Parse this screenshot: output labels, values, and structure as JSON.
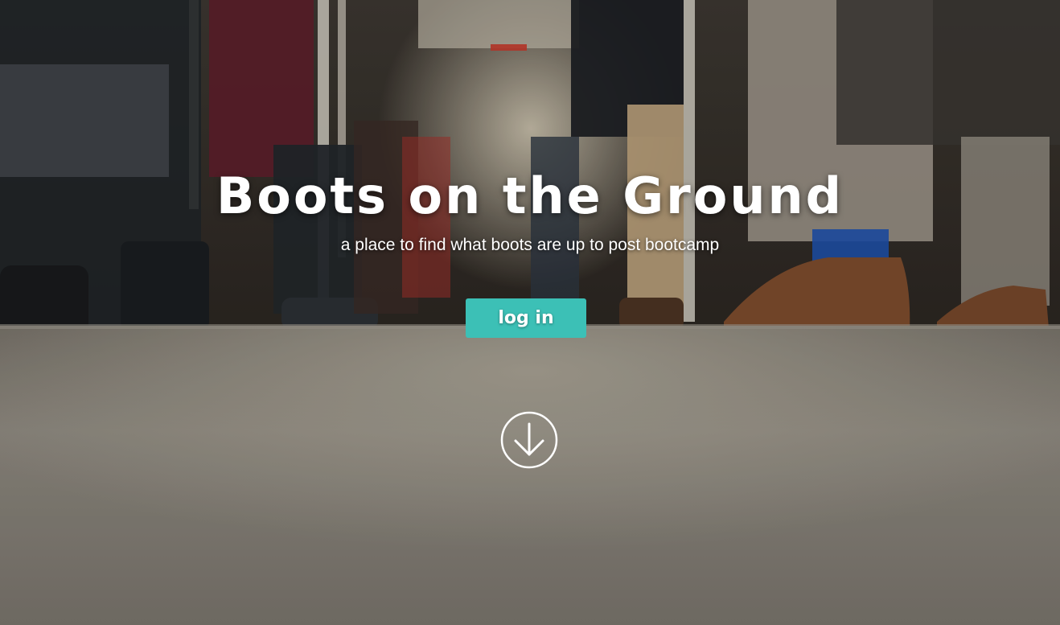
{
  "hero": {
    "title": "Boots on the Ground",
    "subtitle": "a place to find what boots are up to post bootcamp",
    "login_label": "log in",
    "scroll_icon": "arrow-down-circle-icon",
    "background": "subway-car-floor-photo"
  },
  "colors": {
    "button": "#3cc0b6",
    "text": "#ffffff"
  }
}
